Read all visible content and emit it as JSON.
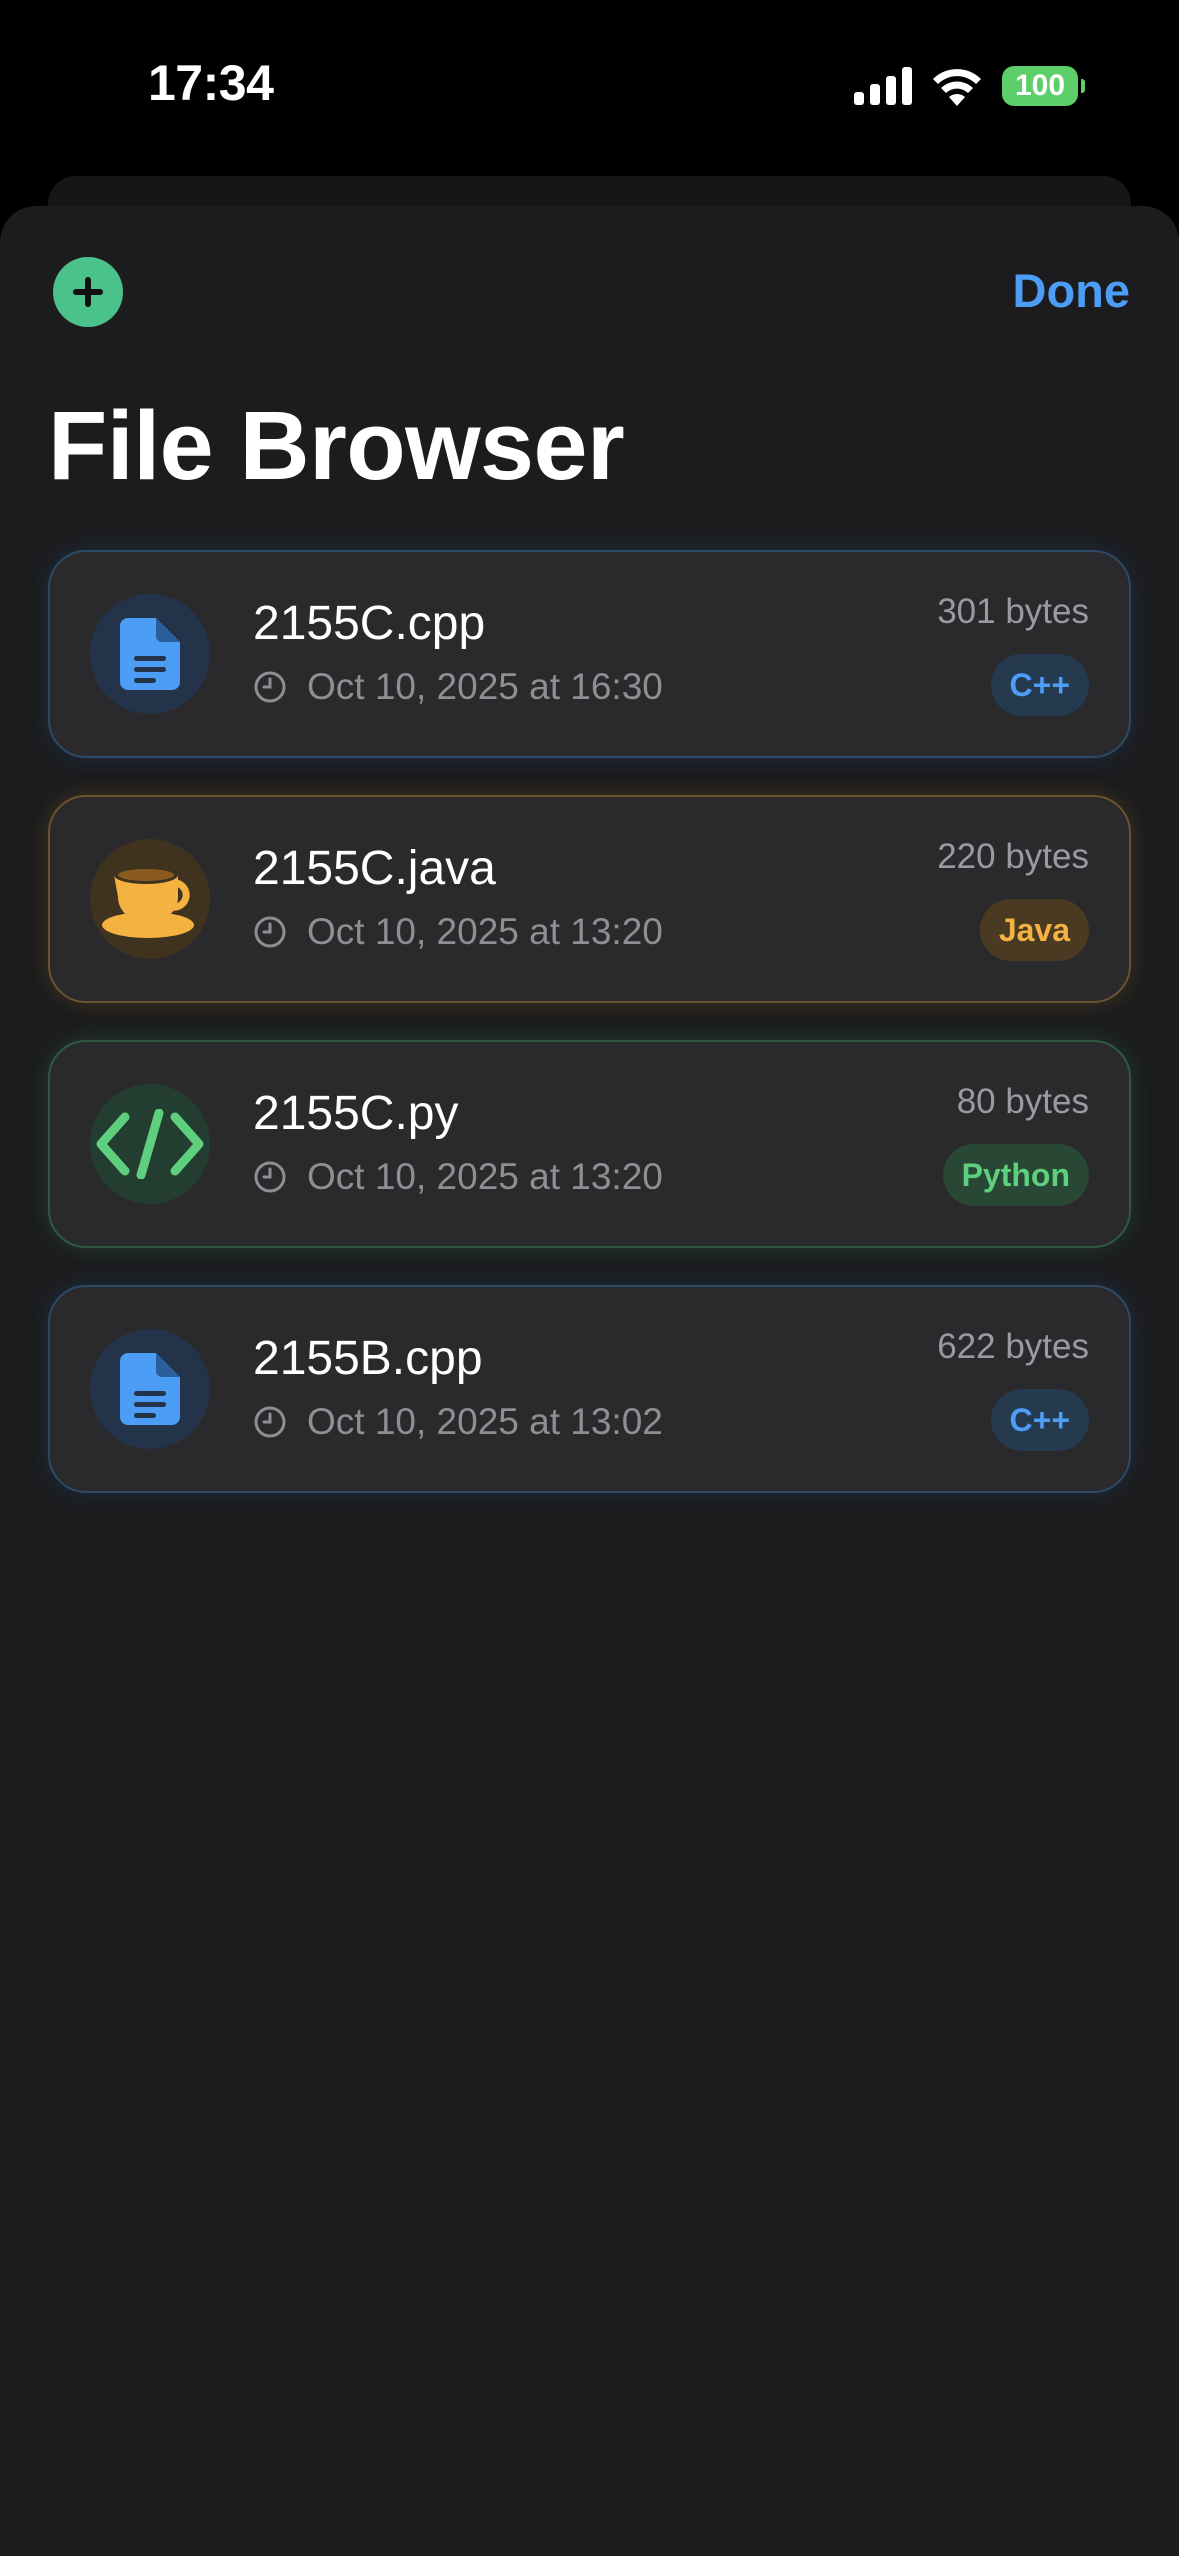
{
  "status_bar": {
    "time": "17:34",
    "battery": "100",
    "icons": [
      "cellular-signal-icon",
      "wifi-icon",
      "battery-icon"
    ]
  },
  "header": {
    "add_icon": "plus-icon",
    "done_label": "Done",
    "title": "File Browser"
  },
  "colors": {
    "accent": "#4c9df5",
    "add_button": "#4bc28a",
    "cpp": "#4c9df5",
    "java": "#f4b341",
    "python": "#5dcf7e"
  },
  "files": [
    {
      "name": "2155C.cpp",
      "date": "Oct 10, 2025 at 16:30",
      "size": "301 bytes",
      "language": "C++",
      "icon": "document-icon"
    },
    {
      "name": "2155C.java",
      "date": "Oct 10, 2025 at 13:20",
      "size": "220 bytes",
      "language": "Java",
      "icon": "coffee-cup-icon"
    },
    {
      "name": "2155C.py",
      "date": "Oct 10, 2025 at 13:20",
      "size": "80 bytes",
      "language": "Python",
      "icon": "code-brackets-icon"
    },
    {
      "name": "2155B.cpp",
      "date": "Oct 10, 2025 at 13:02",
      "size": "622 bytes",
      "language": "C++",
      "icon": "document-icon"
    }
  ]
}
